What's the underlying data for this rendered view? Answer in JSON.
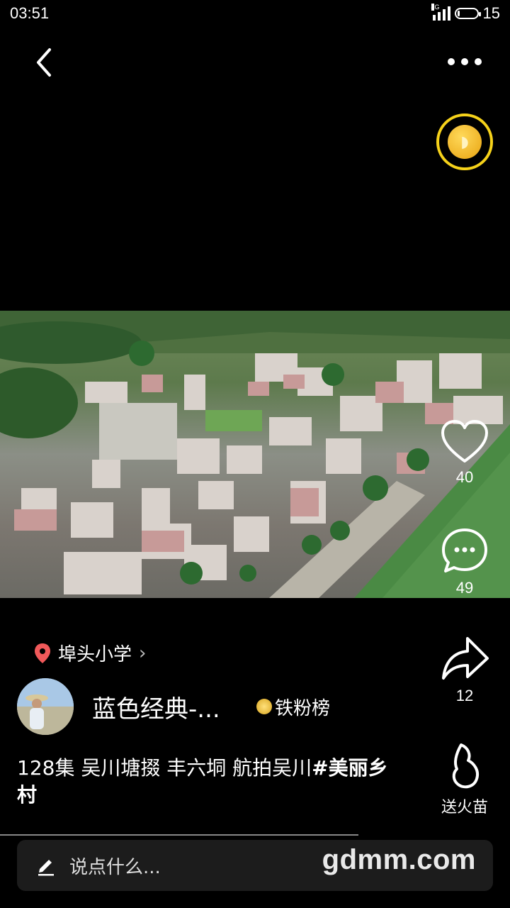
{
  "status_bar": {
    "time": "03:51",
    "network": "4G",
    "battery": "15",
    "battery_level": 0.15
  },
  "video": {
    "description_visible": true
  },
  "actions": {
    "likes": "40",
    "comments": "49",
    "shares": "12",
    "gift_label": "送火苗"
  },
  "location": {
    "name": "埠头小学"
  },
  "author": {
    "name": "蓝色经典-...",
    "badge": "铁粉榜"
  },
  "caption": {
    "text": "128集 吴川塘掇  丰六垌 航拍吴川",
    "tag": "#美丽乡村"
  },
  "comment": {
    "placeholder": "说点什么..."
  },
  "watermark": "gdmm.com",
  "colors": {
    "coin": "#f6d21a",
    "location_pin": "#f0595a"
  },
  "icons": [
    "back-icon",
    "more-icon",
    "coin-icon",
    "heart-icon",
    "comment-icon",
    "share-icon",
    "flame-icon",
    "location-pin-icon",
    "pencil-icon",
    "medal-icon"
  ]
}
